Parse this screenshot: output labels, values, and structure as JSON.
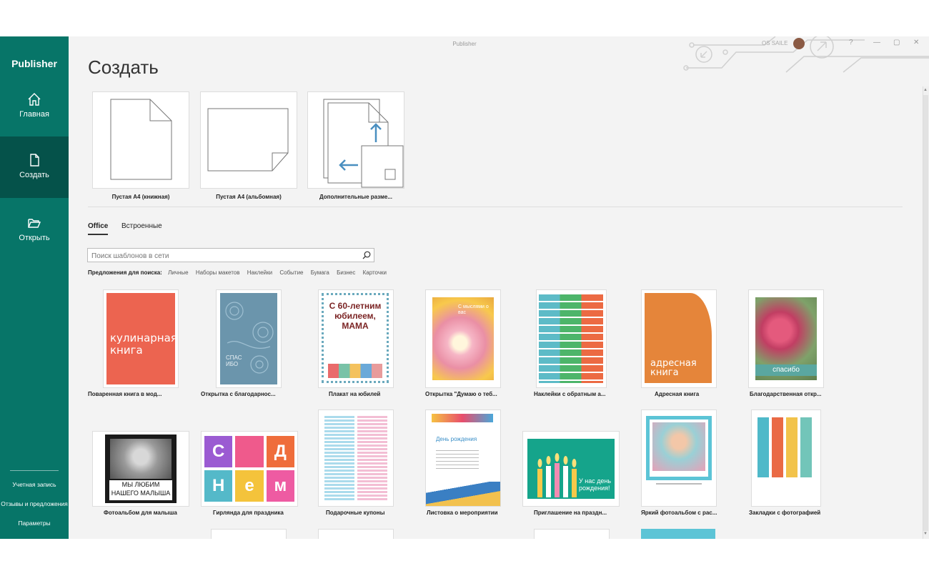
{
  "app": {
    "name": "Publisher",
    "window_title": "Publisher",
    "user_name": "OS SAILE"
  },
  "sidebar": {
    "home": "Главная",
    "new": "Создать",
    "open": "Открыть",
    "account": "Учетная запись",
    "feedback": "Отзывы и предложения",
    "options": "Параметры"
  },
  "main": {
    "title": "Создать",
    "blank_templates": [
      {
        "label": "Пустая А4 (книжная)"
      },
      {
        "label": "Пустая А4 (альбомная)"
      },
      {
        "label": "Дополнительные разме..."
      }
    ],
    "tabs": [
      {
        "label": "Office",
        "active": true
      },
      {
        "label": "Встроенные",
        "active": false
      }
    ],
    "search": {
      "placeholder": "Поиск шаблонов в сети",
      "suggestions_label": "Предложения для поиска:",
      "suggestions": [
        "Личные",
        "Наборы макетов",
        "Наклейки",
        "Событие",
        "Бумага",
        "Бизнес",
        "Карточки"
      ]
    },
    "templates": [
      {
        "label": "Поваренная книга в мод...",
        "thumb_text": "кулинарная книга"
      },
      {
        "label": "Открытка с благодарнос...",
        "thumb_text": "СПАС ИБО"
      },
      {
        "label": "Плакат на юбилей",
        "thumb_text": "С 60-летним юбилеем, МАМА"
      },
      {
        "label": "Открытка \"Думаю о теб...",
        "thumb_text": "С мыслями о вас"
      },
      {
        "label": "Наклейки с обратным а...",
        "thumb_text": ""
      },
      {
        "label": "Адресная книга",
        "thumb_text": "адресная книга"
      },
      {
        "label": "Благодарственная откр...",
        "thumb_text": "спасибо"
      },
      {
        "label": "Фотоальбом для малыша",
        "thumb_text": "МЫ ЛЮБИМ НАШЕГО МАЛЫША"
      },
      {
        "label": "Гирлянда для праздника",
        "thumb_text": "С А Д Н Е М"
      },
      {
        "label": "Подарочные купоны",
        "thumb_text": ""
      },
      {
        "label": "Листовка о мероприятии",
        "thumb_text": "День рождения"
      },
      {
        "label": "Приглашение на праздн...",
        "thumb_text": "У нас день рождения!"
      },
      {
        "label": "Яркий фотоальбом с рас...",
        "thumb_text": ""
      },
      {
        "label": "Закладки с фотографией",
        "thumb_text": ""
      }
    ]
  },
  "colors": {
    "sidebar": "#077568",
    "sidebar_active": "#05524a",
    "background": "#f3f3f3"
  }
}
